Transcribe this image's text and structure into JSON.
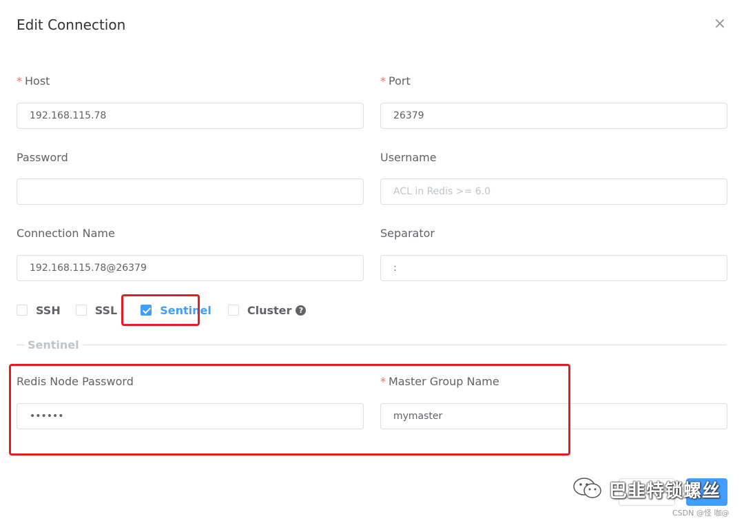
{
  "dialog": {
    "title": "Edit Connection",
    "close_glyph": "×"
  },
  "fields": {
    "host": {
      "label": "Host",
      "required": "*",
      "value": "192.168.115.78"
    },
    "port": {
      "label": "Port",
      "required": "*",
      "value": "26379"
    },
    "password": {
      "label": "Password",
      "value": ""
    },
    "username": {
      "label": "Username",
      "value": "",
      "placeholder": "ACL in Redis >= 6.0"
    },
    "connection_name": {
      "label": "Connection Name",
      "value": "192.168.115.78@26379"
    },
    "separator": {
      "label": "Separator",
      "value": ":"
    }
  },
  "options": {
    "ssh": {
      "label": "SSH",
      "checked": false
    },
    "ssl": {
      "label": "SSL",
      "checked": false
    },
    "sentinel": {
      "label": "Sentinel",
      "checked": true
    },
    "cluster": {
      "label": "Cluster",
      "checked": false,
      "help_glyph": "?"
    }
  },
  "sentinel_section": {
    "divider_label": "Sentinel",
    "node_password": {
      "label": "Redis Node Password",
      "value": "••••••"
    },
    "master_group": {
      "label": "Master Group Name",
      "required": "*",
      "value": "mymaster"
    }
  },
  "watermark": {
    "text": "巴韭特锁螺丝",
    "source": "CSDN @怪 咖@"
  },
  "colors": {
    "accent": "#409eff",
    "required": "#f56c6c",
    "highlight_box": "#e41e1e"
  }
}
